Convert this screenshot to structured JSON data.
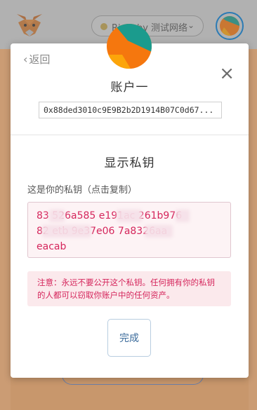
{
  "header": {
    "network_label": "Rinkeby 测试网络"
  },
  "modal": {
    "back_label": "返回",
    "close_symbol": "×",
    "account_name": "账户一",
    "address": "0x88ded3010c9E9B2b2D1914B07C0d67...",
    "section_title": "显示私钥",
    "key_label": "这是你的私钥（点击复制）",
    "private_key_visible_line1": "83  526a585    e191ac   261b976",
    "private_key_visible_line2": "82  etb      9e37e06    7a8326aa",
    "private_key_visible_line3": "eacab",
    "warning": "注意：永远不要公开这个私钥。任何拥有你的私钥的人都可以窃取你账户中的任何资产。",
    "done_label": "完成"
  },
  "colors": {
    "accent_pink": "#d5265c",
    "warning_bg": "#fbe9ec",
    "avatar_orange": "#f5770e",
    "avatar_teal": "#1b9b8d",
    "avatar_light_orange": "#fca50a"
  }
}
